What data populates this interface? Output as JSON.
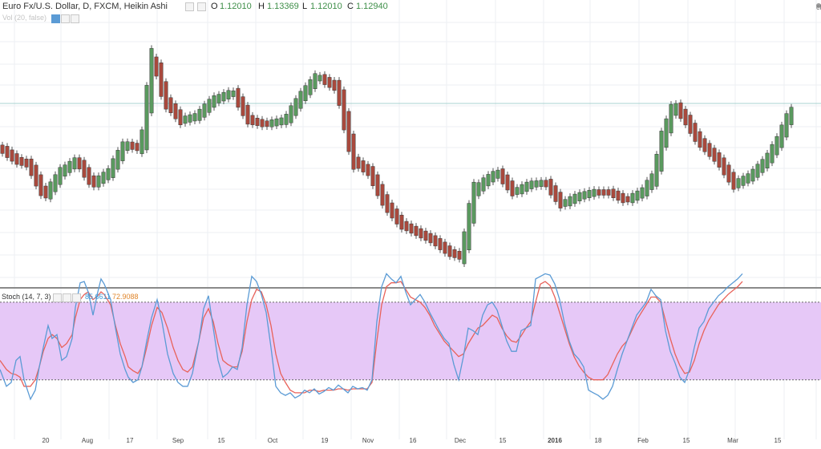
{
  "header": {
    "symbol_title": "Euro Fx/U.S. Dollar, D, FXCM, Heikin Ashi",
    "ohlc": [
      {
        "label": "O",
        "value": "1.12010"
      },
      {
        "label": "H",
        "value": "1.13369"
      },
      {
        "label": "L",
        "value": "1.12010"
      },
      {
        "label": "C",
        "value": "1.12940"
      }
    ],
    "volume_label": "Vol (20, false)",
    "status": "closed"
  },
  "stoch_header": {
    "label": "Stoch (14, 7, 3)",
    "k_value": "85.6611",
    "d_value": "72.9088"
  },
  "colors": {
    "up": "#5a9a5f",
    "down": "#a9493d",
    "k_line": "#5b9bd5",
    "d_line": "#e8625a",
    "band": "#e6c8f7",
    "grid": "#eceff3"
  },
  "chart_data": [
    {
      "type": "candlestick",
      "style": "Heikin Ashi",
      "x_ticks": [
        "20",
        "Aug",
        "17",
        "Sep",
        "15",
        "Oct",
        "19",
        "Nov",
        "16",
        "Dec",
        "15",
        "2016",
        "18",
        "Feb",
        "15",
        "Mar",
        "15"
      ],
      "grid": true
    },
    {
      "type": "line",
      "title": "Stoch (14, 7, 3)",
      "ylim": [
        0,
        100
      ],
      "band": [
        20,
        80
      ],
      "x": [
        0,
        8,
        14,
        20,
        25,
        30,
        38,
        44,
        49,
        54,
        60,
        65,
        71,
        77,
        83,
        90,
        94,
        100,
        105,
        110,
        116,
        122,
        126,
        130,
        138,
        144,
        150,
        156,
        160,
        166,
        172,
        177,
        183,
        189,
        196,
        202,
        209,
        216,
        222,
        228,
        234,
        240,
        248,
        254,
        260,
        266,
        272,
        278,
        284,
        290,
        296,
        302,
        308,
        314,
        320,
        326,
        332,
        338,
        344,
        350,
        356,
        362,
        368,
        374,
        380,
        386,
        392,
        398,
        404,
        410,
        416,
        422,
        428,
        434,
        440,
        446,
        452,
        458,
        464,
        470,
        476,
        482,
        488,
        494,
        500,
        506,
        512,
        518,
        524,
        530,
        536,
        542,
        548,
        554,
        560,
        566,
        572,
        578,
        584,
        590,
        596,
        602,
        608,
        614,
        620,
        626,
        632,
        638,
        644,
        650,
        656,
        662,
        668,
        674,
        680,
        686,
        692,
        698,
        704,
        710,
        716,
        722,
        728,
        734,
        740,
        746,
        752,
        758,
        764,
        770,
        776,
        782,
        788,
        794,
        800,
        806,
        812,
        818,
        824,
        830,
        836,
        842,
        848,
        854,
        860,
        866,
        872,
        878,
        884,
        890,
        896,
        902,
        908,
        914,
        920,
        926,
        932,
        938,
        944,
        950,
        956,
        962,
        968,
        974,
        980,
        986
      ],
      "series": [
        {
          "name": "%K",
          "values": [
            28,
            15,
            18,
            35,
            38,
            20,
            5,
            12,
            30,
            45,
            62,
            52,
            55,
            35,
            38,
            52,
            76,
            95,
            96,
            88,
            70,
            88,
            98,
            94,
            82,
            60,
            40,
            28,
            22,
            18,
            20,
            30,
            50,
            68,
            82,
            65,
            40,
            25,
            18,
            15,
            15,
            25,
            50,
            75,
            85,
            60,
            35,
            22,
            25,
            30,
            28,
            45,
            78,
            100,
            96,
            86,
            72,
            45,
            15,
            10,
            8,
            10,
            6,
            8,
            12,
            10,
            13,
            9,
            11,
            14,
            12,
            16,
            13,
            10,
            15,
            13,
            14,
            12,
            20,
            65,
            92,
            102,
            98,
            95,
            100,
            88,
            78,
            82,
            86,
            80,
            72,
            65,
            58,
            52,
            48,
            32,
            20,
            38,
            60,
            58,
            55,
            70,
            78,
            80,
            74,
            62,
            50,
            42,
            42,
            58,
            60,
            62,
            98,
            100,
            102,
            101,
            94,
            82,
            64,
            50,
            40,
            36,
            30,
            12,
            10,
            8,
            5,
            8,
            15,
            28,
            40,
            50,
            60,
            70,
            75,
            80,
            90,
            85,
            82,
            58,
            42,
            33,
            22,
            18,
            28,
            45,
            60,
            65,
            75,
            80,
            85,
            88,
            92,
            95,
            98,
            102
          ],
          "color": "#5b9bd5"
        },
        {
          "name": "%D",
          "values": [
            35,
            28,
            25,
            24,
            22,
            15,
            15,
            20,
            30,
            42,
            52,
            55,
            52,
            45,
            48,
            55,
            68,
            82,
            86,
            88,
            82,
            85,
            88,
            86,
            78,
            62,
            48,
            38,
            30,
            27,
            25,
            30,
            45,
            62,
            76,
            72,
            60,
            45,
            35,
            28,
            26,
            30,
            50,
            68,
            75,
            65,
            48,
            35,
            32,
            30,
            30,
            42,
            65,
            82,
            90,
            88,
            78,
            62,
            40,
            25,
            18,
            12,
            10,
            10,
            10,
            12,
            12,
            11,
            12,
            12,
            12,
            13,
            13,
            12,
            13,
            13,
            13,
            13,
            18,
            50,
            78,
            92,
            95,
            95,
            96,
            90,
            84,
            82,
            80,
            76,
            70,
            62,
            56,
            50,
            46,
            42,
            38,
            40,
            48,
            54,
            60,
            62,
            66,
            70,
            68,
            60,
            54,
            50,
            49,
            54,
            60,
            65,
            80,
            94,
            96,
            93,
            84,
            72,
            60,
            48,
            38,
            31,
            26,
            22,
            20,
            20,
            20,
            24,
            32,
            40,
            46,
            50,
            58,
            66,
            72,
            78,
            84,
            84,
            80,
            66,
            52,
            40,
            31,
            25,
            26,
            35,
            48,
            58,
            66,
            72,
            78,
            82,
            86,
            89,
            92,
            96
          ],
          "color": "#e8625a"
        }
      ],
      "grid": true
    }
  ]
}
